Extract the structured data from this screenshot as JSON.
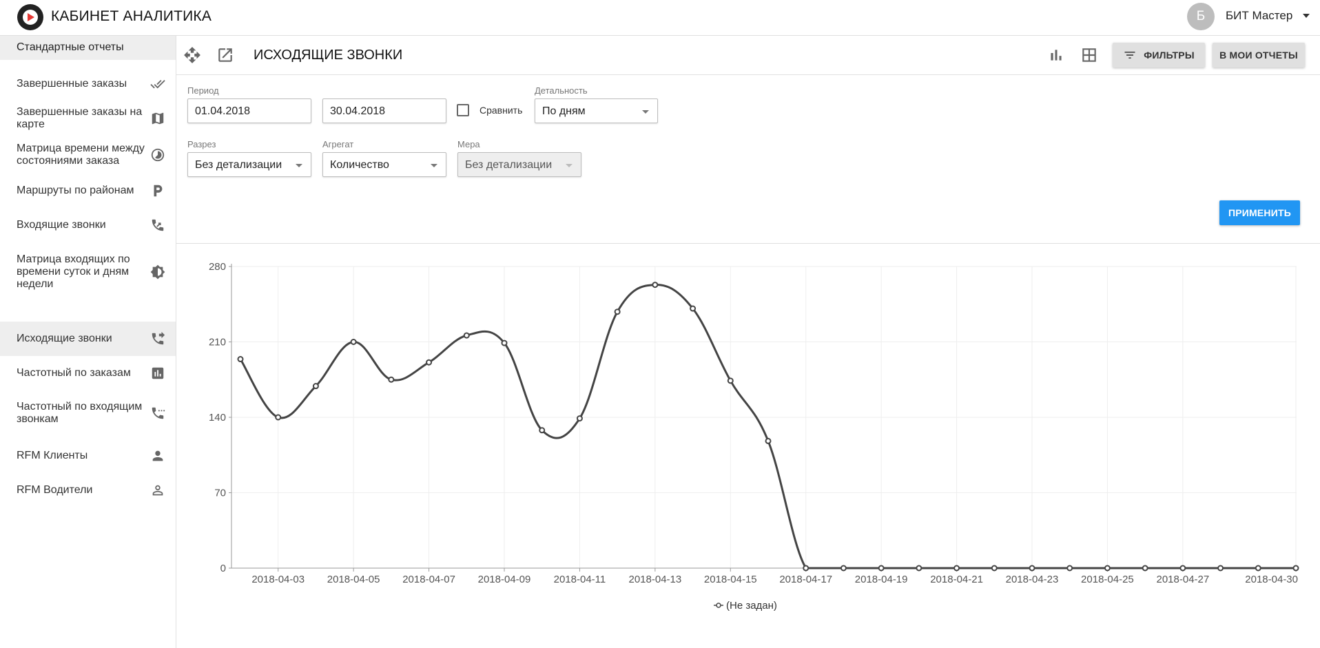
{
  "app": {
    "title": "КАБИНЕТ АНАЛИТИКА"
  },
  "user": {
    "initial": "Б",
    "name": "БИТ Мастер"
  },
  "sidebar": {
    "header": "Стандартные отчеты",
    "items": [
      {
        "label": "Завершенные заказы",
        "icon": "double-check-icon"
      },
      {
        "label": "Завершенные заказы на карте",
        "icon": "map-icon"
      },
      {
        "label": "Матрица времени между состояниями заказа",
        "icon": "timelapse-icon"
      },
      {
        "label": "Маршруты по районам",
        "icon": "parking-icon"
      },
      {
        "label": "Входящие звонки",
        "icon": "phone-forwarded-in-icon"
      },
      {
        "label": "Матрица входящих по времени суток и дням недели",
        "icon": "brightness-icon"
      },
      {
        "label": "Исходящие звонки",
        "icon": "phone-outgoing-icon",
        "active": true
      },
      {
        "label": "Частотный по заказам",
        "icon": "bar-chart-icon"
      },
      {
        "label": "Частотный по входящим звонкам",
        "icon": "phone-dots-icon"
      },
      {
        "label": "RFM Клиенты",
        "icon": "person-icon"
      },
      {
        "label": "RFM Водители",
        "icon": "person-outline-icon"
      }
    ]
  },
  "report": {
    "title": "ИСХОДЯЩИЕ ЗВОНКИ",
    "filters_button": "ФИЛЬТРЫ",
    "my_reports_button": "В МОИ ОТЧЕТЫ",
    "apply_button": "ПРИМЕНИТЬ"
  },
  "form": {
    "period_label": "Период",
    "date_from": "01.04.2018",
    "date_to": "30.04.2018",
    "compare_label": "Сравнить",
    "detail_label": "Детальность",
    "detail_value": "По дням",
    "slice_label": "Разрез",
    "slice_value": "Без детализации",
    "aggregate_label": "Агрегат",
    "aggregate_value": "Количество",
    "measure_label": "Мера",
    "measure_value": "Без детализации"
  },
  "chart_data": {
    "type": "line",
    "x": [
      "2018-04-02",
      "2018-04-03",
      "2018-04-04",
      "2018-04-05",
      "2018-04-06",
      "2018-04-07",
      "2018-04-08",
      "2018-04-09",
      "2018-04-10",
      "2018-04-11",
      "2018-04-12",
      "2018-04-13",
      "2018-04-14",
      "2018-04-15",
      "2018-04-16",
      "2018-04-17",
      "2018-04-18",
      "2018-04-19",
      "2018-04-20",
      "2018-04-21",
      "2018-04-22",
      "2018-04-23",
      "2018-04-24",
      "2018-04-25",
      "2018-04-26",
      "2018-04-27",
      "2018-04-28",
      "2018-04-29",
      "2018-04-30"
    ],
    "xticks": [
      "2018-04-03",
      "2018-04-05",
      "2018-04-07",
      "2018-04-09",
      "2018-04-11",
      "2018-04-13",
      "2018-04-15",
      "2018-04-17",
      "2018-04-19",
      "2018-04-21",
      "2018-04-23",
      "2018-04-25",
      "2018-04-27",
      "2018-04-30"
    ],
    "series": [
      {
        "name": "(Не задан)",
        "values": [
          194,
          140,
          169,
          210,
          175,
          191,
          216,
          209,
          128,
          139,
          238,
          263,
          241,
          174,
          118,
          0,
          0,
          0,
          0,
          0,
          0,
          0,
          0,
          0,
          0,
          0,
          0,
          0,
          0
        ]
      }
    ],
    "ylim": [
      0,
      280
    ],
    "yticks": [
      0,
      70,
      140,
      210,
      280
    ],
    "grid": true,
    "legend": "bottom",
    "line_color": "#444444"
  }
}
